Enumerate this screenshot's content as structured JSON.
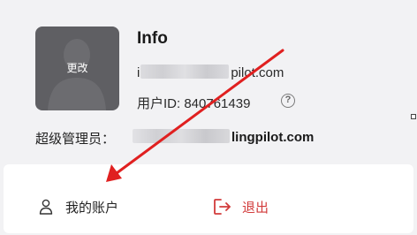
{
  "profile": {
    "avatar_action_label": "更改",
    "name": "Info",
    "email_prefix": "i",
    "email_suffix": "pilot.com",
    "user_id_label": "用户ID: ",
    "user_id_value": "840761439",
    "help_symbol": "?",
    "admin_label": "超级管理员：",
    "admin_email_suffix": "lingpilot.com"
  },
  "actions": {
    "my_account_label": "我的账户",
    "logout_label": "退出"
  },
  "colors": {
    "logout": "#d23b3b",
    "annotation_arrow": "#e02020"
  },
  "icons": {
    "my_account": "user-icon",
    "logout": "logout-icon",
    "help": "question-circle-icon"
  }
}
